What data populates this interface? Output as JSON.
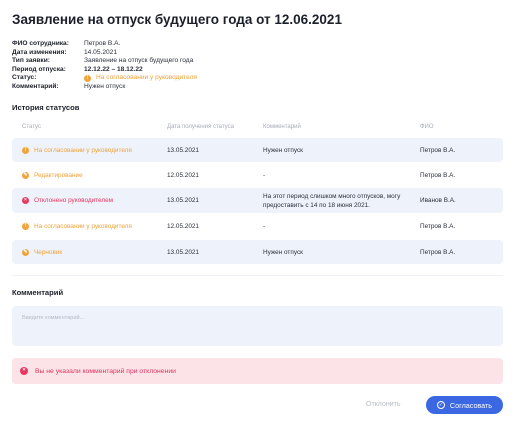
{
  "title": "Заявление на отпуск будущего года от 12.06.2021",
  "info": [
    {
      "label": "ФИО сотрудника:",
      "value": "Петров В.А."
    },
    {
      "label": "Дата изменения:",
      "value": "14.05.2021"
    },
    {
      "label": "Тип заявки:",
      "value": "Заявление на отпуск будущего года"
    },
    {
      "label": "Период отпуска:",
      "value": "12.12.22 – 18.12.22"
    },
    {
      "label": "Статус:",
      "value": "На согласовании у руководителя",
      "icon": "warning-icon",
      "color": "#f0a23a"
    },
    {
      "label": "Комментарий:",
      "value": "Нужен отпуск"
    }
  ],
  "history": {
    "heading": "История статусов",
    "columns": [
      "Статус",
      "Дата получения статуса",
      "Комментарий",
      "ФИО"
    ],
    "rows": [
      {
        "status": "На согласовании у руководителя",
        "icon": "warning-icon",
        "date": "13.05.2021",
        "comment": "Нужен отпуск",
        "fio": "Петров В.А."
      },
      {
        "status": "Редактирование",
        "icon": "pencil-icon",
        "date": "12.05.2021",
        "comment": "-",
        "fio": "Петров В.А."
      },
      {
        "status": "Отклонено руководителем",
        "icon": "close-icon",
        "date": "13.05.2021",
        "comment": "На этот период слишком много отпусков, могу предоставить с 14 по 18 июня 2021.",
        "fio": "Иванов В.А."
      },
      {
        "status": "На согласовании у руководителя",
        "icon": "warning-icon",
        "date": "12.05.2021",
        "comment": "-",
        "fio": "Петров В.А."
      },
      {
        "status": "Черновик",
        "icon": "pencil-icon",
        "date": "13.05.2021",
        "comment": "Нужен отпуск",
        "fio": "Петров В.А."
      }
    ]
  },
  "comment": {
    "heading": "Комментарий",
    "placeholder": "Введите комментарий..."
  },
  "alert": {
    "text": "Вы не указали комментарий при отклонении",
    "color": "#e0345b"
  },
  "actions": {
    "reject_label": "Отклонить",
    "approve_label": "Согласовать",
    "accent": "#3b67e3"
  }
}
